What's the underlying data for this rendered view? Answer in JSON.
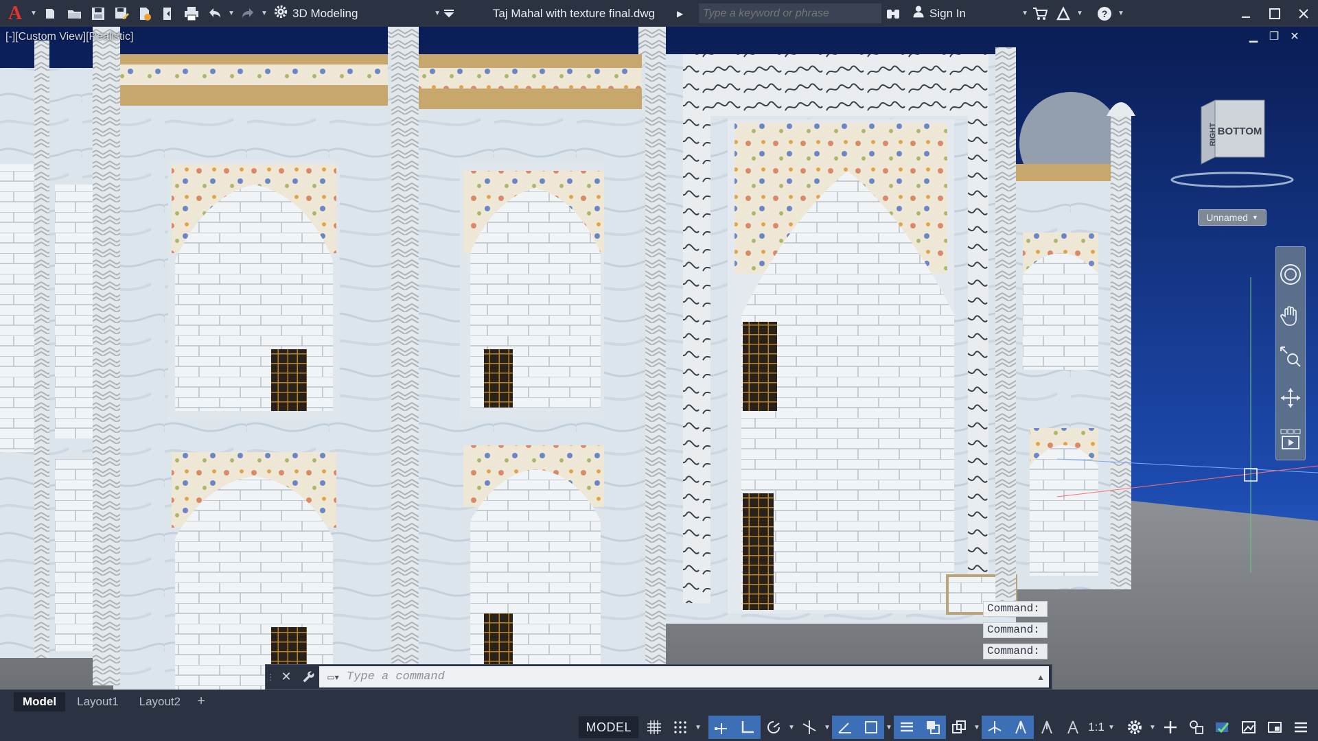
{
  "titlebar": {
    "app_logo": "A",
    "workspace_label": "3D Modeling",
    "file_title": "Taj Mahal with texture final.dwg",
    "search_placeholder": "Type a keyword or phrase",
    "sign_in_label": "Sign In",
    "icons": [
      "new-icon",
      "open-icon",
      "save-icon",
      "save-as-icon",
      "open-from-web-icon",
      "save-to-web-icon",
      "plot-icon",
      "undo-icon",
      "redo-icon"
    ]
  },
  "viewport": {
    "view_label": "[-][Custom View][Realistic]",
    "viewcube_face_top": "BOTTOM",
    "viewcube_face_side": "RIGHT",
    "ucs_label": "Unnamed",
    "sky_color": "#0f2a6b",
    "marble_color": "#dfe6ec"
  },
  "command": {
    "history": [
      "Command:",
      "Command:",
      "Command:"
    ],
    "placeholder": "Type a command"
  },
  "tabs": {
    "items": [
      "Model",
      "Layout1",
      "Layout2"
    ],
    "active": "Model"
  },
  "statusbar": {
    "model_label": "MODEL",
    "annotation_scale": "1:1"
  }
}
